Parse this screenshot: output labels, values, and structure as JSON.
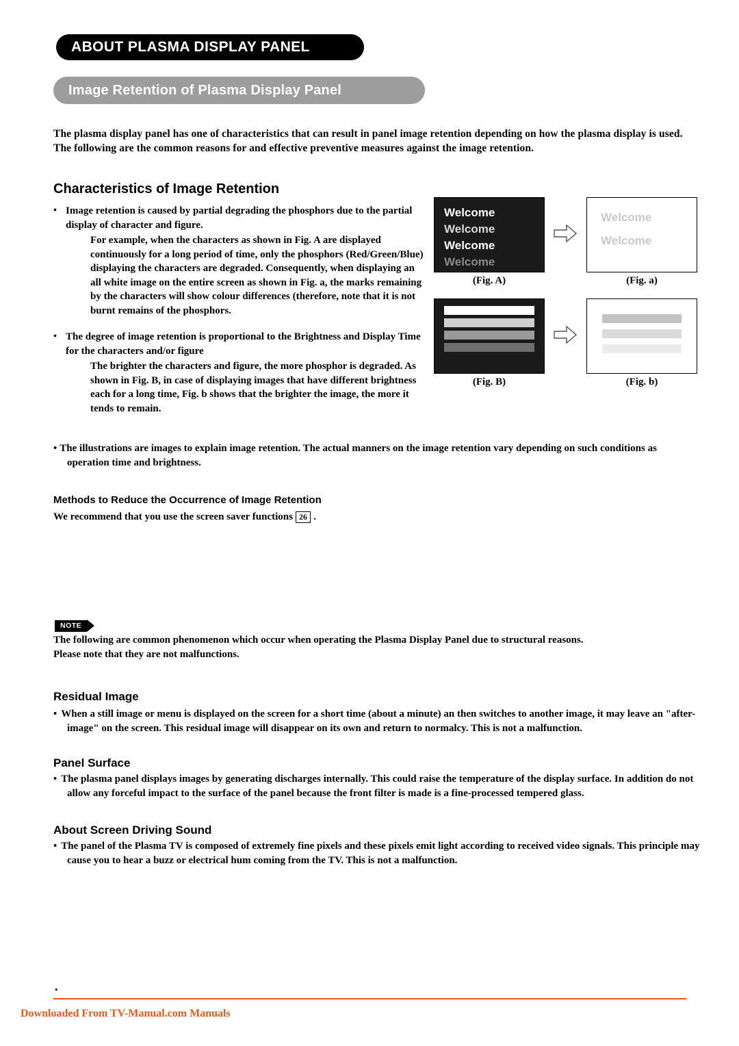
{
  "header": {
    "chapter_title": "ABOUT PLASMA DISPLAY PANEL",
    "section_title": "Image Retention of Plasma Display Panel"
  },
  "intro": "The plasma display panel has one of characteristics that can result in panel image retention depending on how the plasma display is used. The following are the common reasons for and effective preventive measures against the image retention.",
  "characteristics": {
    "title": "Characteristics of Image Retention",
    "bullet1": {
      "marker": "•",
      "text": "Image retention is caused by partial degrading the phosphors due to the partial display of character and figure.",
      "sub": "For example, when the characters as shown in Fig. A are displayed continuously for a long period of time, only the phosphors (Red/Green/Blue) displaying the characters are degraded. Consequently, when displaying an all white image on the entire screen as shown in Fig. a, the marks remaining by the characters will show colour differences (therefore, note that it is not burnt remains of the phosphors."
    },
    "bullet2": {
      "marker": "•",
      "text": "The degree of image retention is proportional to the Brightness and Display Time for the characters and/or figure",
      "sub": "The brighter the characters and figure, the more phosphor is degraded. As shown in Fig. B, in case of displaying images that have different brightness each for a long time, Fig. b shows that the brighter the image, the more it tends to remain."
    }
  },
  "figures": {
    "figA": {
      "caption": "(Fig. A)",
      "lines": [
        "Welcome",
        "Welcome",
        "Welcome",
        "Welcome"
      ]
    },
    "figa": {
      "caption": "(Fig. a)",
      "lines": [
        "Welcome",
        "Welcome"
      ]
    },
    "figB": {
      "caption": "(Fig. B)",
      "bars": [
        "#ffffff",
        "#000000",
        "#cfcfcf",
        "#000000",
        "#9a9a9a",
        "#000000",
        "#6e6e6e"
      ]
    },
    "figb": {
      "caption": "(Fig. b)",
      "bars": [
        "#c4c4c4",
        "#d9d9d9",
        "#ececec"
      ]
    },
    "arrow_icon": "right-arrow-icon"
  },
  "illustration_note": {
    "marker": "•",
    "text": "The illustrations are images to explain image retention. The actual manners on the image retention vary depending on such conditions as operation time and brightness."
  },
  "methods": {
    "title": "Methods to Reduce the Occurrence of Image Retention",
    "body_before": "We recommend that you use the screen saver functions",
    "page_ref": "26",
    "body_after": "."
  },
  "note": {
    "tag_label": "NOTE",
    "line1": "The following are common phenomenon which occur when operating the Plasma Display Panel due to structural reasons.",
    "line2": "Please note that they are not malfunctions."
  },
  "sections": [
    {
      "title": "Residual Image",
      "marker": "•",
      "body": "When a still image or menu is displayed on the screen for a short time (about a minute) an then switches to another image, it may leave an \"after-image\" on the screen. This residual image will disappear on its own and return to normalcy. This is not a malfunction."
    },
    {
      "title": "Panel Surface",
      "marker": "•",
      "body": "The plasma panel displays images by generating discharges internally. This could raise the temperature of the display surface. In addition do not allow any forceful impact to the surface of the panel because the front filter is made is a fine-processed tempered glass."
    },
    {
      "title": "About Screen Driving Sound",
      "marker": "•",
      "body": "The panel of the Plasma TV is composed of extremely fine pixels and these pixels emit light according to received video signals. This principle may cause you to hear a buzz or electrical hum coming from the TV. This is not a malfunction."
    }
  ],
  "footer": {
    "mark": "•",
    "text": "Downloaded From TV-Manual.com Manuals",
    "accent_color": "#e85a1a"
  }
}
